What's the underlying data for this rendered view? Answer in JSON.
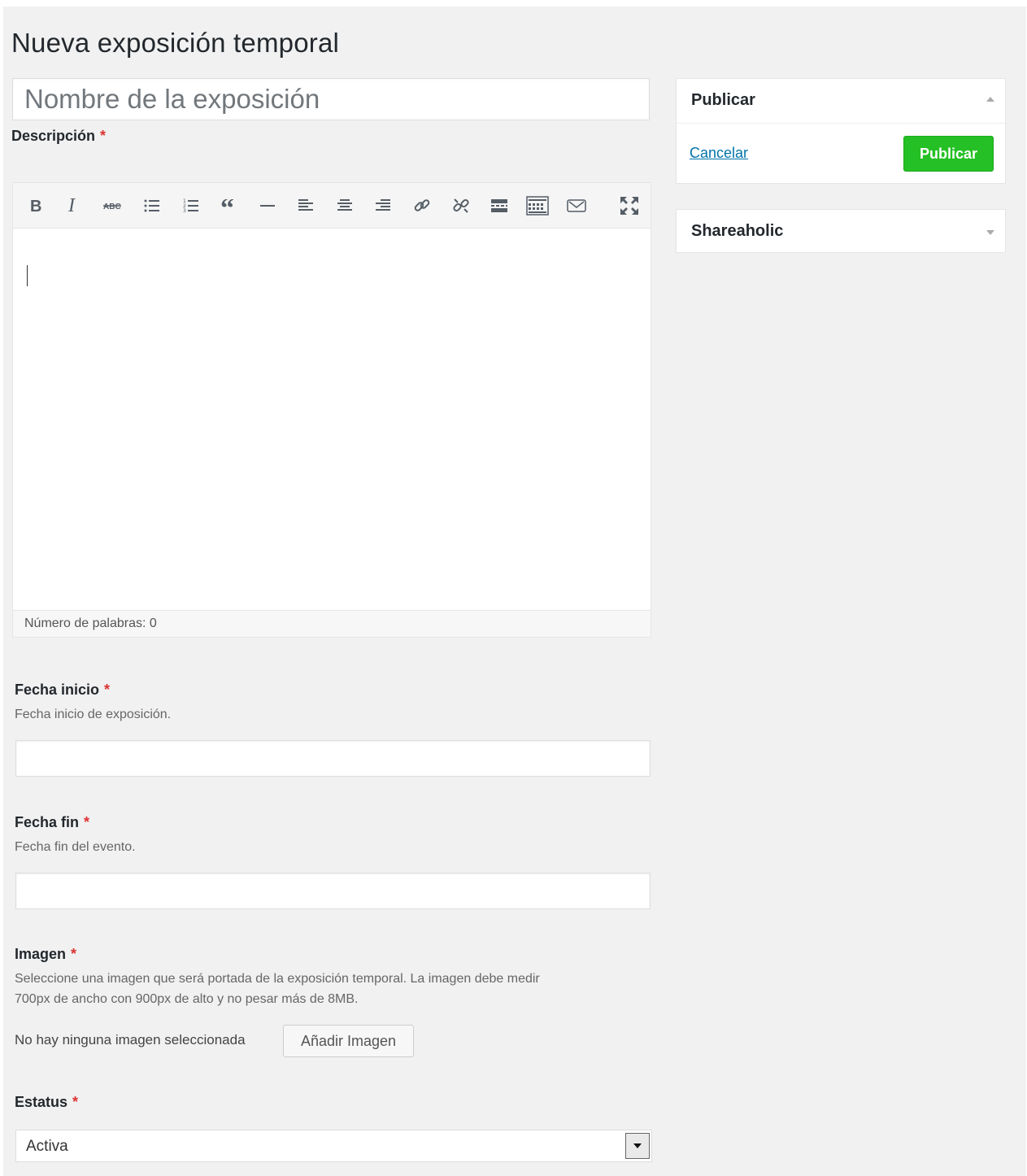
{
  "page": {
    "title": "Nueva exposición temporal"
  },
  "title_field": {
    "placeholder": "Nombre de la exposición"
  },
  "description": {
    "label": "Descripción",
    "required_mark": "*",
    "toolbar": [
      "bold-icon",
      "italic-icon",
      "strikethrough-icon",
      "bullet-list-icon",
      "numbered-list-icon",
      "blockquote-icon",
      "horizontal-rule-icon",
      "align-left-icon",
      "align-center-icon",
      "align-right-icon",
      "link-icon",
      "unlink-icon",
      "read-more-icon",
      "toolbar-toggle-icon",
      "mail-icon",
      "fullscreen-icon"
    ],
    "word_count": "Número de palabras: 0"
  },
  "fecha_inicio": {
    "label": "Fecha inicio",
    "required_mark": "*",
    "help": "Fecha inicio de exposición."
  },
  "fecha_fin": {
    "label": "Fecha fin",
    "required_mark": "*",
    "help": "Fecha fin del evento."
  },
  "imagen": {
    "label": "Imagen",
    "required_mark": "*",
    "help_line1": "Seleccione una imagen que será portada de la exposición temporal. La imagen debe medir",
    "help_line2": "700px de ancho con 900px de alto y no pesar más de 8MB.",
    "status": "No hay ninguna imagen seleccionada",
    "button": "Añadir Imagen"
  },
  "estatus": {
    "label": "Estatus",
    "required_mark": "*",
    "selected": "Activa"
  },
  "sidebar": {
    "publish_box": {
      "title": "Publicar",
      "cancel": "Cancelar",
      "publish_button": "Publicar"
    },
    "shareaholic_box": {
      "title": "Shareaholic"
    }
  },
  "colors": {
    "background": "#f1f1f1",
    "required": "#dc3232",
    "link": "#0073aa",
    "publish_button": "#25c025"
  }
}
